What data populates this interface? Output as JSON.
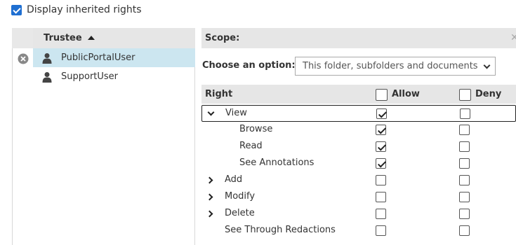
{
  "display_inherited": {
    "label": "Display inherited rights",
    "checked": true
  },
  "trustees": {
    "header": "Trustee",
    "sort": "ascending",
    "items": [
      {
        "name": "PublicPortalUser",
        "selected": true
      },
      {
        "name": "SupportUser",
        "selected": false
      }
    ]
  },
  "scope": {
    "title": "Scope:",
    "choose_label": "Choose an option:",
    "selected_option": "This folder, subfolders and documents"
  },
  "rights": {
    "columns": {
      "right": "Right",
      "allow": "Allow",
      "deny": "Deny"
    },
    "rows": [
      {
        "name": "View",
        "expander": "expanded",
        "allow": true,
        "deny": false
      },
      {
        "name": "Browse",
        "expander": "none",
        "allow": true,
        "deny": false
      },
      {
        "name": "Read",
        "expander": "none",
        "allow": true,
        "deny": false
      },
      {
        "name": "See Annotations",
        "expander": "none",
        "allow": true,
        "deny": false
      },
      {
        "name": "Add",
        "expander": "collapsed",
        "allow": false,
        "deny": false
      },
      {
        "name": "Modify",
        "expander": "collapsed",
        "allow": false,
        "deny": false
      },
      {
        "name": "Delete",
        "expander": "collapsed",
        "allow": false,
        "deny": false
      },
      {
        "name": "See Through Redactions",
        "expander": "none",
        "allow": false,
        "deny": false
      }
    ]
  },
  "colors": {
    "selection": "#cce6f0",
    "header": "#e6e6e6",
    "checkbox_blue": "#1f6fd1"
  }
}
